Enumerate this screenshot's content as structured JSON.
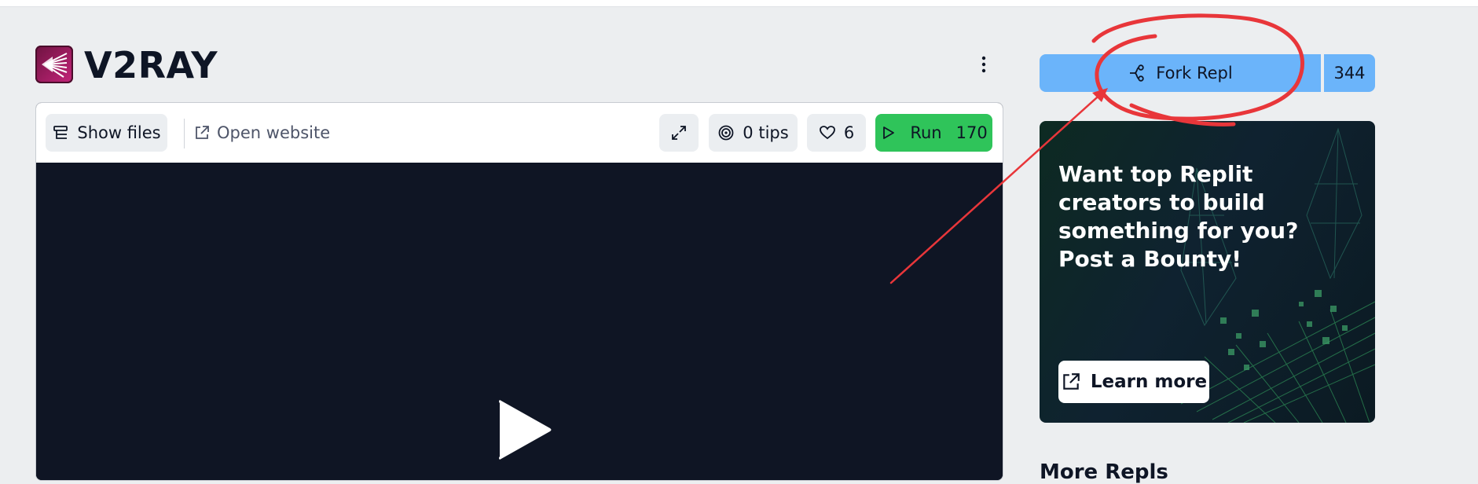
{
  "repl": {
    "title": "V2RAY",
    "logo_icon": "repl-cover-icon",
    "menu_icon": "kebab-menu-icon"
  },
  "toolbar": {
    "show_files": "Show files",
    "open_website": "Open website",
    "tips": "0 tips",
    "likes": "6",
    "run": "Run",
    "run_count": "170"
  },
  "sidebar": {
    "fork_label": "Fork Repl",
    "fork_count": "344",
    "bounty_text": "Want top Replit creators to build something for you? Post a Bounty!",
    "learn_more": "Learn more",
    "more_repls": "More Repls"
  },
  "colors": {
    "run_green": "#2fc45a",
    "fork_blue": "#6bb4fa",
    "annotation_red": "#e8363a",
    "video_bg": "#0f1524"
  }
}
